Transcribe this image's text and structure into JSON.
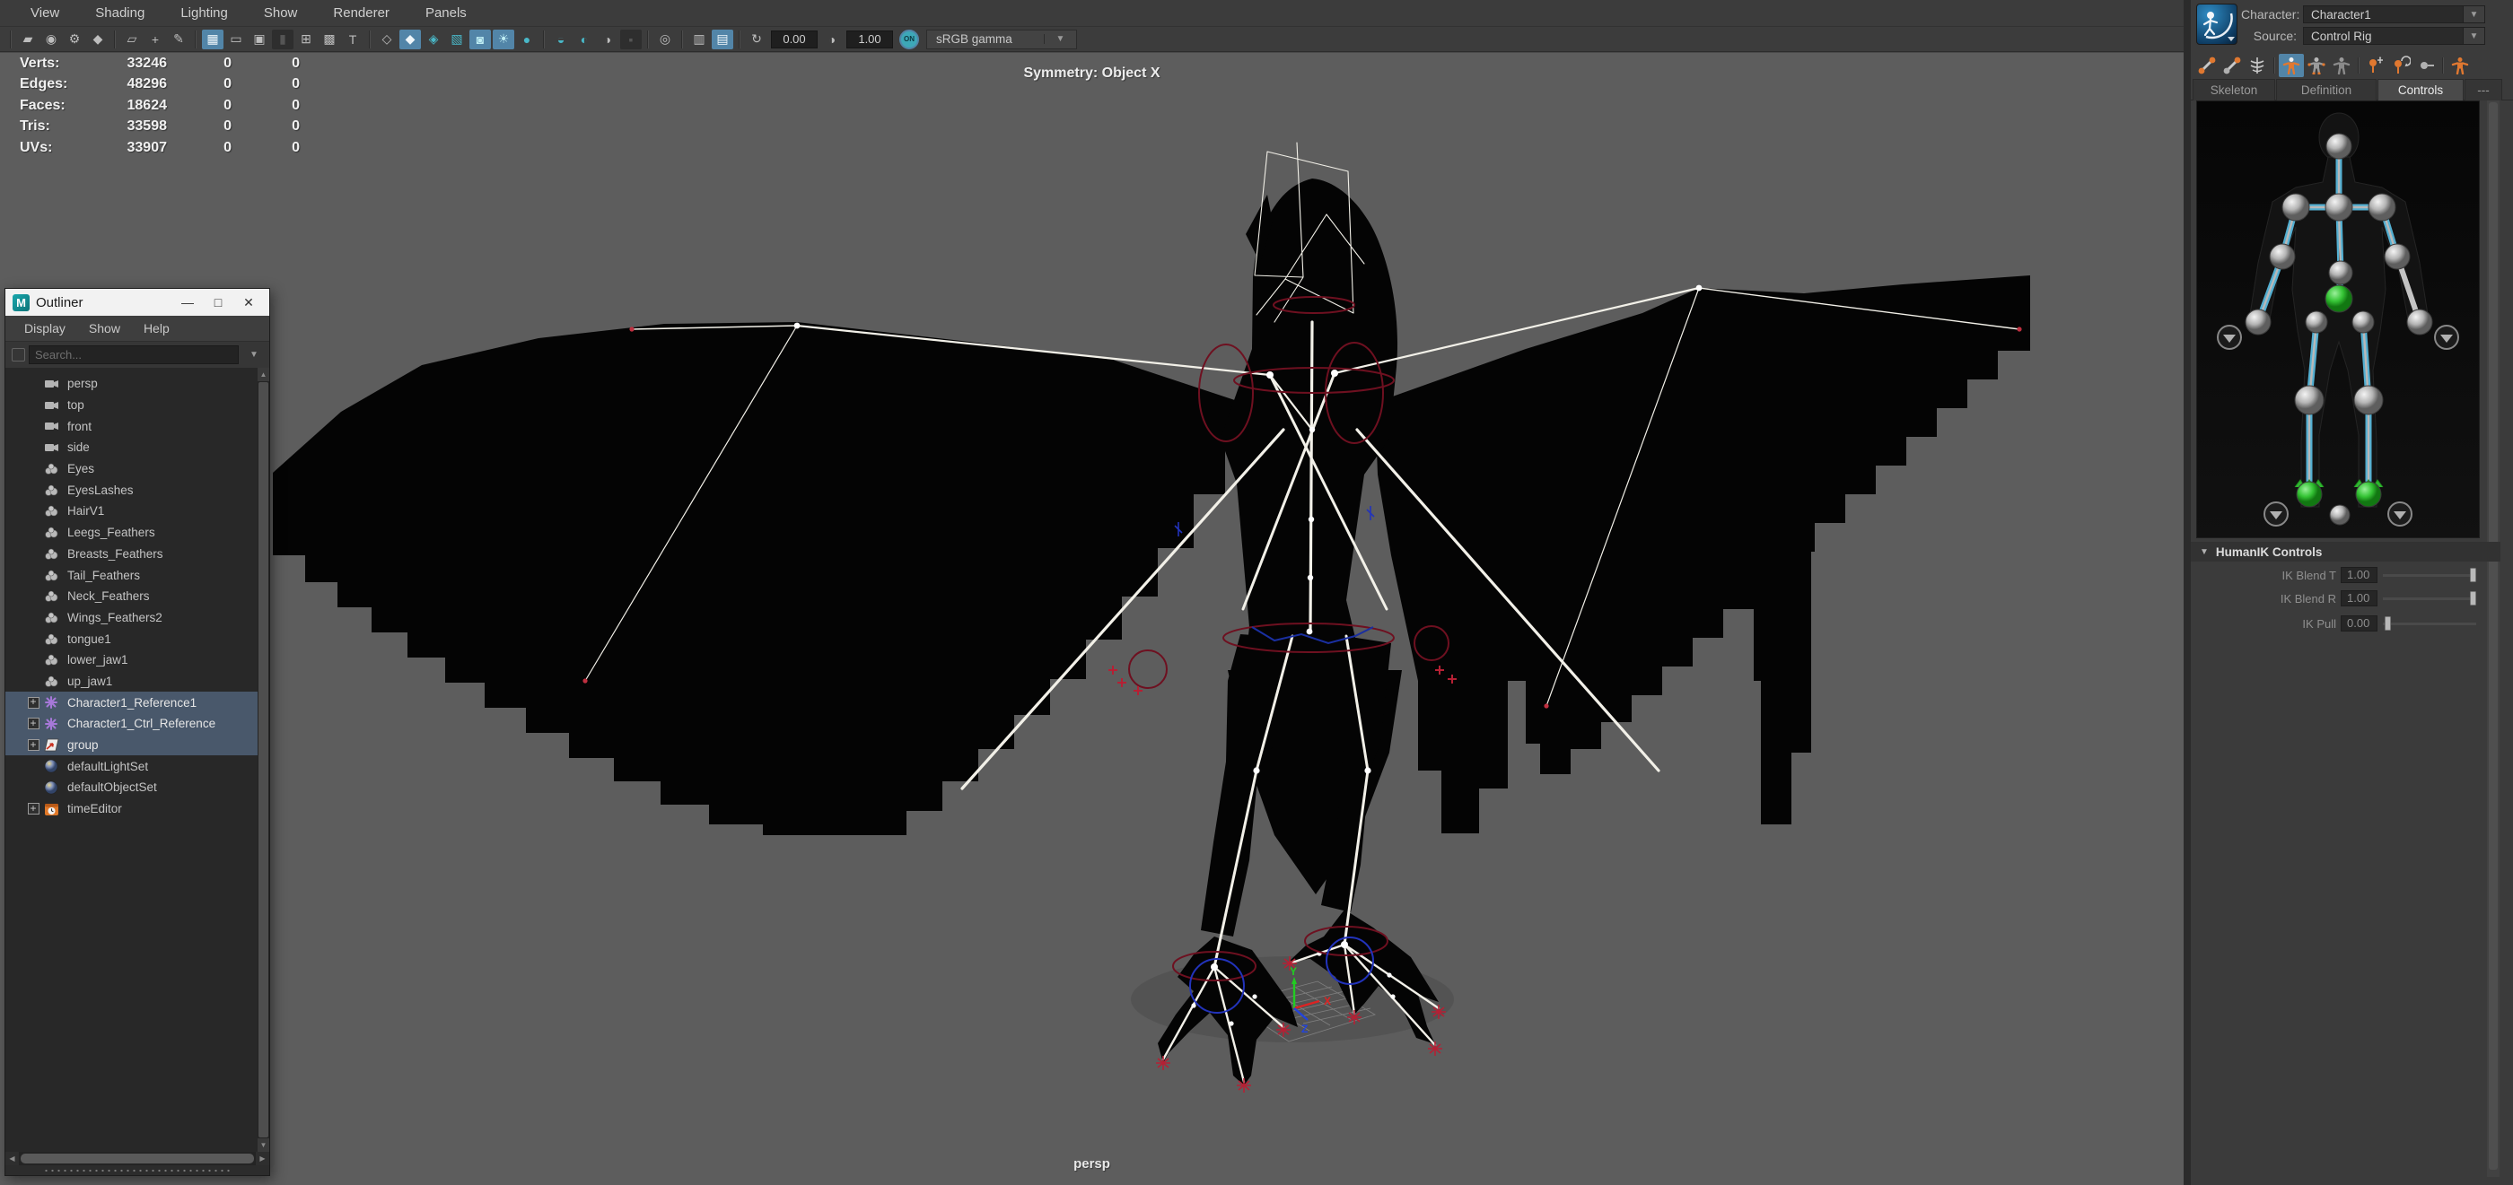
{
  "menubar": {
    "items": [
      "View",
      "Shading",
      "Lighting",
      "Show",
      "Renderer",
      "Panels"
    ]
  },
  "toolbar": {
    "exposure_value": "0.00",
    "contrast_value": "1.00",
    "on_label": "ON",
    "gamma_label": "sRGB gamma",
    "icons": [
      {
        "glyph": "▰"
      },
      {
        "glyph": "◉"
      },
      {
        "glyph": "⚙"
      },
      {
        "glyph": "◆"
      },
      {
        "glyph": "▱"
      },
      {
        "glyph": "+"
      },
      {
        "glyph": "✎"
      },
      {
        "glyph": "▦"
      },
      {
        "glyph": "▭"
      },
      {
        "glyph": "▣"
      },
      {
        "glyph": "▮"
      },
      {
        "glyph": "⊞"
      },
      {
        "glyph": "▩"
      },
      {
        "glyph": "T"
      },
      {
        "glyph": "◇"
      },
      {
        "glyph": "◆"
      },
      {
        "glyph": "◈"
      },
      {
        "glyph": "▧"
      },
      {
        "glyph": "◙"
      },
      {
        "glyph": "☀"
      },
      {
        "glyph": "●"
      },
      {
        "glyph": "◒"
      },
      {
        "glyph": "◐"
      },
      {
        "glyph": "◑"
      },
      {
        "glyph": "▪"
      },
      {
        "glyph": "◎"
      },
      {
        "glyph": "▥"
      },
      {
        "glyph": "▤"
      },
      {
        "glyph": "↻"
      },
      {
        "glyph": "◑"
      }
    ]
  },
  "viewport": {
    "symmetry_label": "Symmetry: Object X",
    "camera_label": "persp",
    "hud": {
      "rows": [
        {
          "label": "Verts:",
          "total": "33246",
          "c1": "0",
          "c2": "0"
        },
        {
          "label": "Edges:",
          "total": "48296",
          "c1": "0",
          "c2": "0"
        },
        {
          "label": "Faces:",
          "total": "18624",
          "c1": "0",
          "c2": "0"
        },
        {
          "label": "Tris:",
          "total": "33598",
          "c1": "0",
          "c2": "0"
        },
        {
          "label": "UVs:",
          "total": "33907",
          "c1": "0",
          "c2": "0"
        }
      ]
    }
  },
  "outliner": {
    "window_title": "Outliner",
    "minimize_glyph": "—",
    "maximize_glyph": "□",
    "close_glyph": "✕",
    "menu_items": [
      "Display",
      "Show",
      "Help"
    ],
    "search_placeholder": "Search...",
    "items": [
      {
        "label": "persp",
        "icon": "camera"
      },
      {
        "label": "top",
        "icon": "camera"
      },
      {
        "label": "front",
        "icon": "camera"
      },
      {
        "label": "side",
        "icon": "camera"
      },
      {
        "label": "Eyes",
        "icon": "mesh"
      },
      {
        "label": "EyesLashes",
        "icon": "mesh"
      },
      {
        "label": "HairV1",
        "icon": "mesh"
      },
      {
        "label": "Leegs_Feathers",
        "icon": "mesh"
      },
      {
        "label": "Breasts_Feathers",
        "icon": "mesh"
      },
      {
        "label": "Tail_Feathers",
        "icon": "mesh"
      },
      {
        "label": "Neck_Feathers",
        "icon": "mesh"
      },
      {
        "label": "Wings_Feathers2",
        "icon": "mesh"
      },
      {
        "label": "tongue1",
        "icon": "mesh"
      },
      {
        "label": "lower_jaw1",
        "icon": "mesh"
      },
      {
        "label": "up_jaw1",
        "icon": "mesh"
      },
      {
        "label": "Character1_Reference1",
        "icon": "character-reference",
        "selected": true,
        "expandable": true
      },
      {
        "label": "Character1_Ctrl_Reference",
        "icon": "character-reference",
        "selected": true,
        "expandable": true
      },
      {
        "label": "group",
        "icon": "group-transform",
        "selected": true,
        "expandable": true
      },
      {
        "label": "defaultLightSet",
        "icon": "set"
      },
      {
        "label": "defaultObjectSet",
        "icon": "set"
      },
      {
        "label": "timeEditor",
        "icon": "time-editor",
        "expandable": true
      }
    ]
  },
  "character_panel": {
    "character_label": "Character:",
    "character_value": "Character1",
    "source_label": "Source:",
    "source_value": "Control Rig",
    "tabs": [
      "Skeleton",
      "Definition",
      "Controls",
      "---"
    ],
    "active_tab": "Controls",
    "section_title": "HumanIK Controls",
    "controls": [
      {
        "label": "IK Blend T",
        "value": "1.00",
        "slider": "right"
      },
      {
        "label": "IK Blend R",
        "value": "1.00",
        "slider": "right"
      },
      {
        "label": "IK Pull",
        "value": "0.00",
        "slider": "left"
      }
    ]
  },
  "colors": {
    "viewport_bg": "#5d5d5d",
    "accent_blue": "#5285a8",
    "selection_row": "#49586b",
    "teal_icon": "#49b8c8",
    "hik_green": "#3ecf3e",
    "bone_cyan": "#74cdea",
    "control_red": "#6e1020",
    "rig_white": "#f2f0e8",
    "panel_bg": "#3b3b3b"
  }
}
